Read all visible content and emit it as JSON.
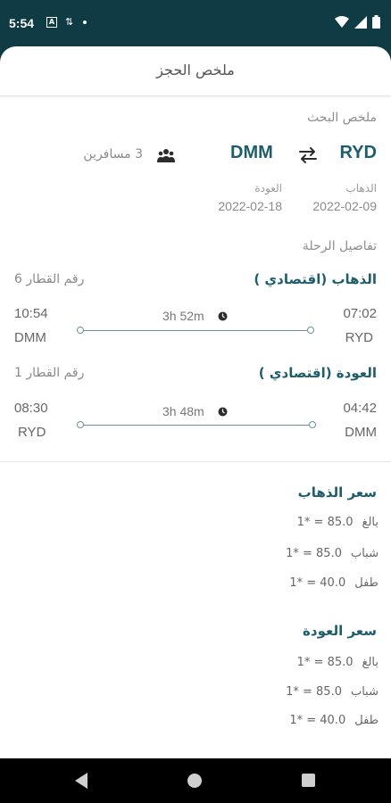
{
  "status_bar": {
    "time": "5:54",
    "icons": [
      "a-icon",
      "data-transfer-icon",
      "dot-icon",
      "wifi-icon",
      "signal-icon",
      "battery-icon"
    ]
  },
  "header": {
    "title": "ملخص الحجز"
  },
  "search_summary": {
    "title": "ملخص البحث",
    "origin": "RYD",
    "destination": "DMM",
    "passengers": "3 مسافرين",
    "depart_label": "الذهاب",
    "depart_date": "2022-02-09",
    "return_label": "العودة",
    "return_date": "2022-02-18"
  },
  "trip_details": {
    "title": "تفاصيل الرحلة",
    "outbound": {
      "title": "الذهاب (اقتصادي )",
      "train_number": "رقم القطار 6",
      "depart_time": "07:02",
      "depart_code": "RYD",
      "arrive_time": "10:54",
      "arrive_code": "DMM",
      "duration": "3h 52m"
    },
    "inbound": {
      "title": "العودة (اقتصادي )",
      "train_number": "رقم القطار 1",
      "depart_time": "04:42",
      "depart_code": "DMM",
      "arrive_time": "08:30",
      "arrive_code": "RYD",
      "duration": "3h 48m"
    }
  },
  "fares": {
    "outbound": {
      "title": "سعر الذهاب",
      "rows": [
        {
          "label": "بالغ",
          "value": "1* = 85.0"
        },
        {
          "label": "شباب",
          "value": "1* = 85.0"
        },
        {
          "label": "طفل",
          "value": "1* = 40.0"
        }
      ]
    },
    "inbound": {
      "title": "سعر العودة",
      "rows": [
        {
          "label": "بالغ",
          "value": "1* = 85.0"
        },
        {
          "label": "شباب",
          "value": "1* = 85.0"
        },
        {
          "label": "طفل",
          "value": "1* = 40.0"
        }
      ]
    }
  },
  "colors": {
    "primary": "#1e5d6b",
    "status_bar": "#0e3b44"
  }
}
